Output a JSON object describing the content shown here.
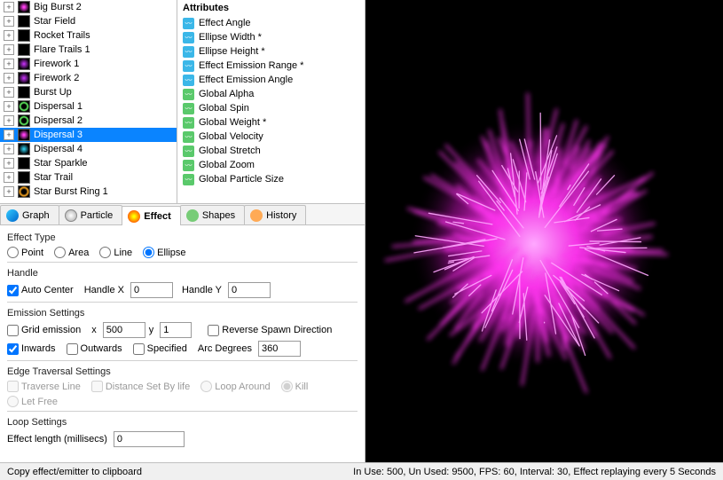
{
  "tree": {
    "items": [
      {
        "label": "Big Burst 2",
        "thumb": "purple"
      },
      {
        "label": "Star Field",
        "thumb": "black"
      },
      {
        "label": "Rocket Trails",
        "thumb": "black"
      },
      {
        "label": "Flare Trails 1",
        "thumb": "black"
      },
      {
        "label": "Firework 1",
        "thumb": "firework"
      },
      {
        "label": "Firework 2",
        "thumb": "firework"
      },
      {
        "label": "Burst Up",
        "thumb": "black"
      },
      {
        "label": "Dispersal 1",
        "thumb": "ringgreen"
      },
      {
        "label": "Dispersal 2",
        "thumb": "ringgreen"
      },
      {
        "label": "Dispersal 3",
        "thumb": "purple",
        "selected": true
      },
      {
        "label": "Dispersal 4",
        "thumb": "glowblue"
      },
      {
        "label": "Star Sparkle",
        "thumb": "black"
      },
      {
        "label": "Star Trail",
        "thumb": "black"
      },
      {
        "label": "Star Burst Ring 1",
        "thumb": "ringorange"
      }
    ]
  },
  "attributes": {
    "header": "Attributes",
    "rows": [
      {
        "label": "Effect Angle",
        "c": "blue"
      },
      {
        "label": "Ellipse Width *",
        "c": "blue"
      },
      {
        "label": "Ellipse Height *",
        "c": "blue"
      },
      {
        "label": "Effect Emission Range *",
        "c": "blue"
      },
      {
        "label": "Effect Emission Angle",
        "c": "blue"
      },
      {
        "label": "Global Alpha",
        "c": "green"
      },
      {
        "label": "Global Spin",
        "c": "green"
      },
      {
        "label": "Global Weight *",
        "c": "green"
      },
      {
        "label": "Global Velocity",
        "c": "green"
      },
      {
        "label": "Global Stretch",
        "c": "green"
      },
      {
        "label": "Global Zoom",
        "c": "green"
      },
      {
        "label": "Global Particle Size",
        "c": "green"
      }
    ]
  },
  "tabs": {
    "items": [
      {
        "label": "Graph",
        "ico": "tico-graph"
      },
      {
        "label": "Particle",
        "ico": "tico-particle"
      },
      {
        "label": "Effect",
        "ico": "tico-effect",
        "active": true
      },
      {
        "label": "Shapes",
        "ico": "tico-shapes"
      },
      {
        "label": "History",
        "ico": "tico-history"
      }
    ]
  },
  "effect": {
    "type_label": "Effect Type",
    "types": {
      "point": "Point",
      "area": "Area",
      "line": "Line",
      "ellipse": "Ellipse"
    },
    "selected_type": "ellipse",
    "handle_label": "Handle",
    "auto_center": "Auto Center",
    "handle_x_label": "Handle X",
    "handle_x": "0",
    "handle_y_label": "Handle Y",
    "handle_y": "0",
    "emission_label": "Emission Settings",
    "grid_emission": "Grid emission",
    "grid_x_label": "x",
    "grid_x": "500",
    "grid_y_label": "y",
    "grid_y": "1",
    "reverse": "Reverse Spawn Direction",
    "inwards": "Inwards",
    "outwards": "Outwards",
    "specified": "Specified",
    "arc_label": "Arc Degrees",
    "arc": "360",
    "edge_label": "Edge Traversal Settings",
    "traverse": "Traverse Line",
    "dist_life": "Distance Set By life",
    "loop_around": "Loop Around",
    "kill": "Kill",
    "let_free": "Let Free",
    "loop_label": "Loop Settings",
    "effect_len_label": "Effect length (millisecs)",
    "effect_len": "0"
  },
  "status": {
    "left": "Copy effect/emitter to clipboard",
    "right": "In Use: 500, Un Used: 9500, FPS: 60, Interval: 30, Effect replaying every 5 Seconds"
  }
}
